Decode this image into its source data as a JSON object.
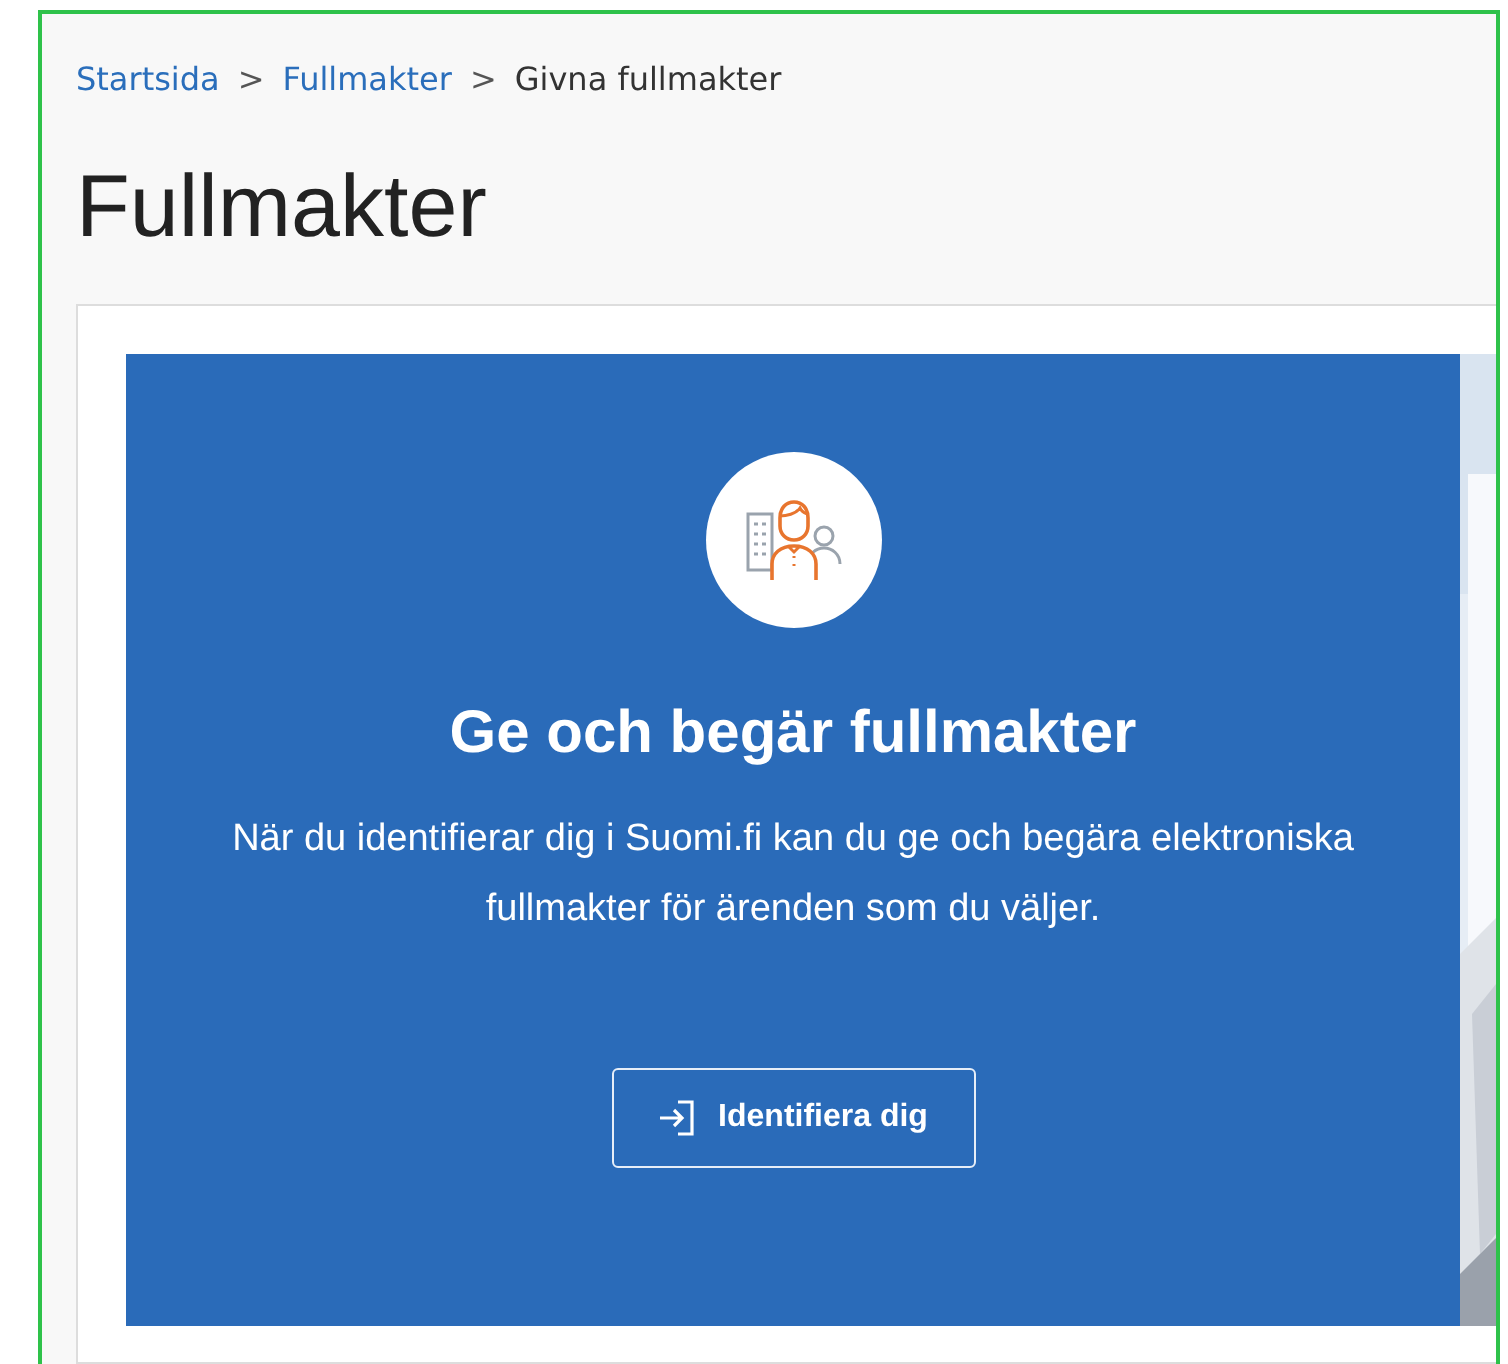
{
  "breadcrumb": [
    {
      "label": "Startsida",
      "kind": "link"
    },
    {
      "label": "Fullmakter",
      "kind": "link"
    },
    {
      "label": "Givna fullmakter",
      "kind": "current"
    }
  ],
  "breadcrumb_separator": ">",
  "title": "Fullmakter",
  "hero": {
    "heading": "Ge och begär fullmakter",
    "text": "När du identifierar dig i Suomi.fi kan du ge och begära elektroniska fullmakter för ärenden som du väljer.",
    "button": "Identifiera dig"
  }
}
